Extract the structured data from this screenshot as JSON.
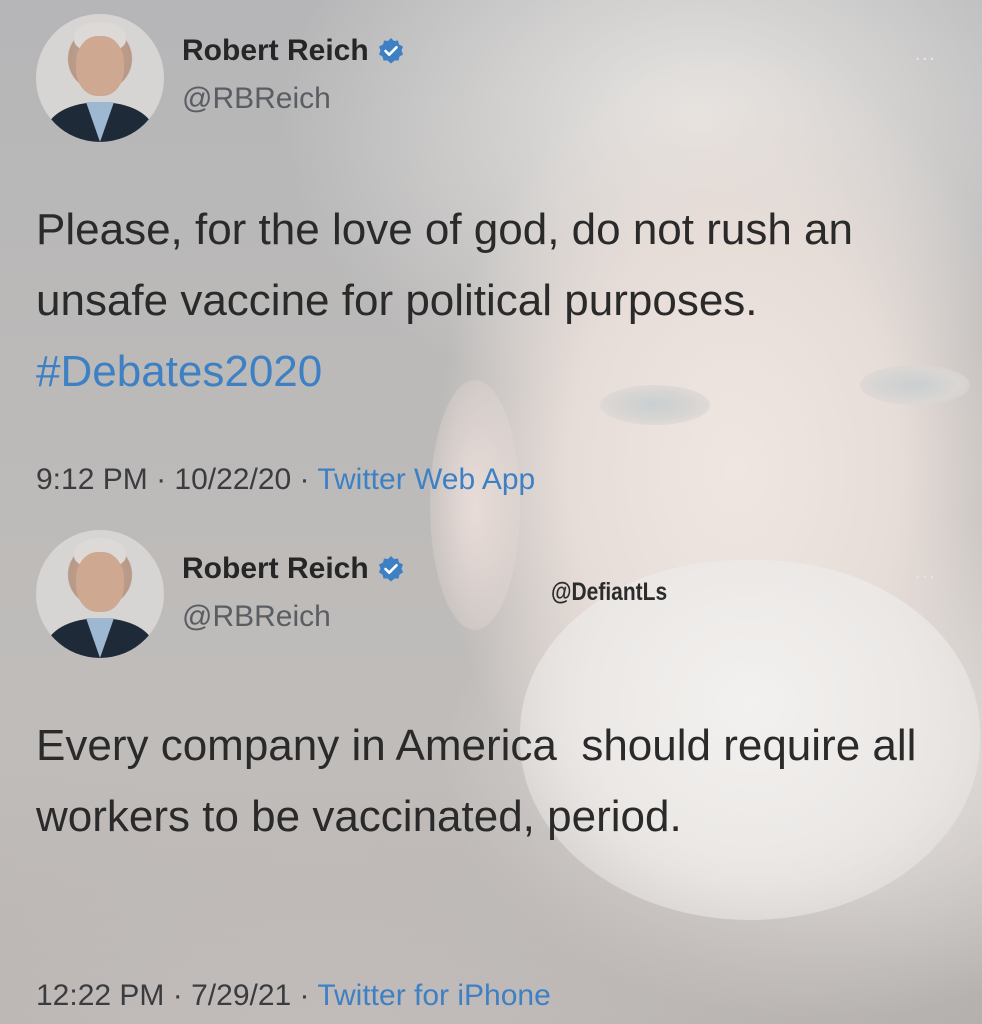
{
  "tweets": [
    {
      "author": {
        "name": "Robert Reich",
        "handle": "@RBReich",
        "verified": true,
        "avatar_icon": "profile-photo"
      },
      "more_label": "...",
      "body": "Please, for the love of god, do not rush an unsafe vaccine for political purposes.",
      "hashtag": "#Debates2020",
      "time": "9:12 PM",
      "date": "10/22/20",
      "source": "Twitter Web App"
    },
    {
      "author": {
        "name": "Robert Reich",
        "handle": "@RBReich",
        "verified": true,
        "avatar_icon": "profile-photo"
      },
      "more_label": "...",
      "body": "Every company in America  should require all workers to be vaccinated, period.",
      "hashtag": "",
      "time": "12:22 PM",
      "date": "7/29/21",
      "source": "Twitter for iPhone"
    }
  ],
  "watermark": "@DefiantLs",
  "separator": "·",
  "colors": {
    "link": "#3e80c4",
    "verified": "#3e80c4",
    "text": "#2a2a2a"
  }
}
